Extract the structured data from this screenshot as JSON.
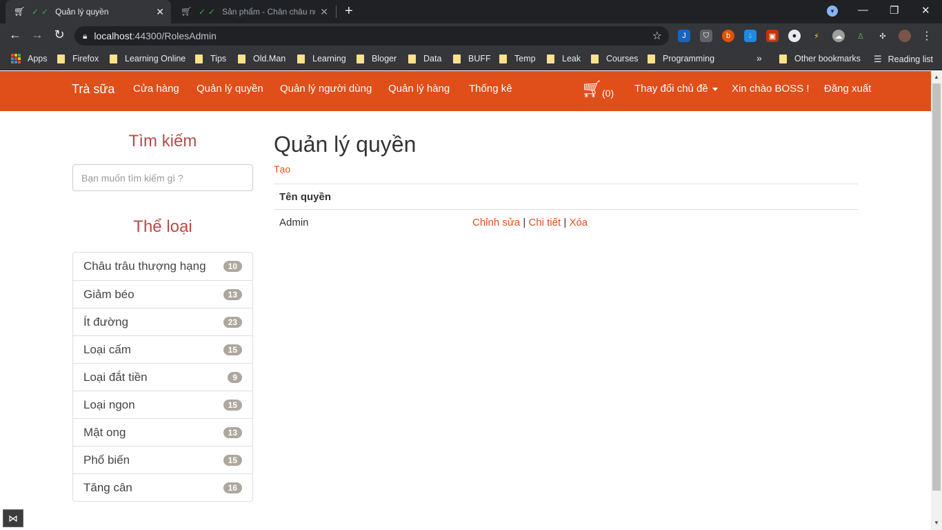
{
  "browser": {
    "tabs": [
      {
        "title": "Quản lý quyền",
        "active": true
      },
      {
        "title": "Sản phẩm - Chân châu nu",
        "active": false
      }
    ],
    "url_host": "localhost",
    "url_rest": ":44300/RolesAdmin",
    "bookmarks": [
      "Apps",
      "Firefox",
      "Learning Online",
      "Tips",
      "Old.Man",
      "Learning",
      "Bloger",
      "Data",
      "BUFF",
      "Temp",
      "Leak",
      "Courses",
      "Programming"
    ],
    "other_bookmarks": "Other bookmarks",
    "reading_list": "Reading list",
    "overflow": "»"
  },
  "navbar": {
    "brand": "Trà sữa",
    "links": [
      "Cửa hàng",
      "Quản lý quyền",
      "Quản lý người dùng",
      "Quản lý hàng",
      "Thống kê"
    ],
    "cart_count": "(0)",
    "theme_label": "Thay đổi chủ đề",
    "greeting": "Xin chào BOSS !",
    "logout": "Đăng xuất",
    "color": "#e04e1a"
  },
  "sidebar": {
    "search_heading": "Tìm kiếm",
    "search_placeholder": "Bạn muốn tìm kiếm gì ?",
    "category_heading": "Thể loại",
    "categories": [
      {
        "name": "Châu trâu thượng hạng",
        "count": "10"
      },
      {
        "name": "Giảm béo",
        "count": "13"
      },
      {
        "name": "Ít đường",
        "count": "23"
      },
      {
        "name": "Loại cấm",
        "count": "15"
      },
      {
        "name": "Loại đắt tiền",
        "count": "9"
      },
      {
        "name": "Loại ngon",
        "count": "15"
      },
      {
        "name": "Mật ong",
        "count": "13"
      },
      {
        "name": "Phổ biến",
        "count": "15"
      },
      {
        "name": "Tăng cân",
        "count": "16"
      }
    ]
  },
  "main": {
    "title": "Quản lý quyền",
    "create_link": "Tạo",
    "column_header": "Tên quyền",
    "rows": [
      {
        "name": "Admin",
        "edit": "Chỉnh sửa",
        "details": "Chi tiết",
        "delete": "Xóa",
        "sep": "|"
      }
    ]
  }
}
